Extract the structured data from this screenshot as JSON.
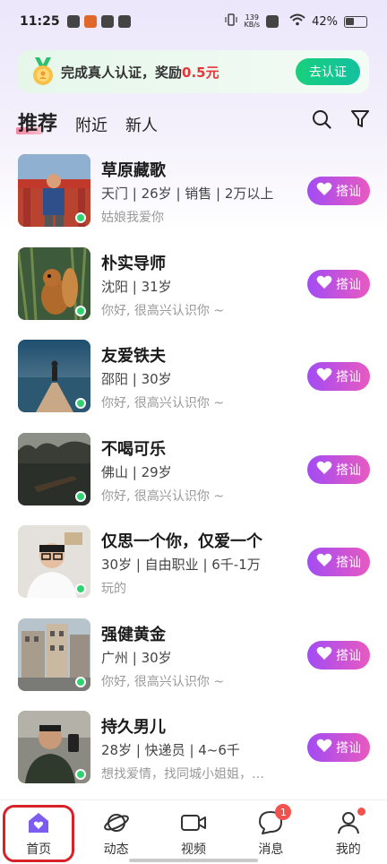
{
  "status_bar": {
    "time": "11:25",
    "network_speed_top": "139",
    "network_speed_bottom": "KB/s",
    "battery": "42%"
  },
  "banner": {
    "text_prefix": "完成真人认证，奖励",
    "reward": "0.5元",
    "button_label": "去认证"
  },
  "tabs": [
    "推荐",
    "附近",
    "新人"
  ],
  "users": [
    {
      "name": "草原藏歌",
      "info": "天门 | 26岁 | 销售 | 2万以上",
      "bio": "姑娘我爱你",
      "greet": "搭讪"
    },
    {
      "name": "朴实导师",
      "info": "沈阳 | 31岁",
      "bio": "你好, 很高兴认识你 ~",
      "greet": "搭讪"
    },
    {
      "name": "友爱铁夫",
      "info": "邵阳 | 30岁",
      "bio": "你好, 很高兴认识你 ~",
      "greet": "搭讪"
    },
    {
      "name": "不喝可乐",
      "info": "佛山 | 29岁",
      "bio": "你好, 很高兴认识你 ~",
      "greet": "搭讪"
    },
    {
      "name": "仅思一个你，仅爱一个",
      "info": "30岁 | 自由职业 | 6千-1万",
      "bio": "玩的",
      "greet": "搭讪"
    },
    {
      "name": "强健黄金",
      "info": "广州 | 30岁",
      "bio": "你好, 很高兴认识你 ~",
      "greet": "搭讪"
    },
    {
      "name": "持久男儿",
      "info": "28岁 | 快递员 | 4~6千",
      "bio": "想找爱情，找同城小姐姐，…",
      "greet": "搭讪"
    }
  ],
  "bottom_nav": [
    {
      "label": "首页",
      "icon": "home-icon",
      "active": true
    },
    {
      "label": "动态",
      "icon": "planet-icon"
    },
    {
      "label": "视频",
      "icon": "video-icon"
    },
    {
      "label": "消息",
      "icon": "message-icon",
      "badge": "1"
    },
    {
      "label": "我的",
      "icon": "profile-icon"
    }
  ],
  "colors": {
    "accent_purple": "#a34bf4",
    "accent_pink": "#e85ac0",
    "verify_green": "#18d07d",
    "online_green": "#2fd36f",
    "reward_red": "#e8353a"
  }
}
